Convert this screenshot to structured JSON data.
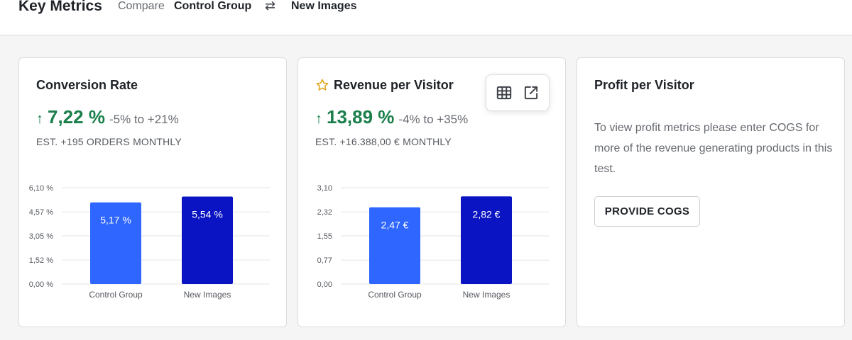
{
  "header": {
    "title": "Key Metrics",
    "compare_label": "Compare",
    "group_a": "Control Group",
    "swap_icon": "⇄",
    "group_b": "New Images"
  },
  "colors": {
    "positive": "#1a7f4b",
    "control_bar": "#2e66ff",
    "variant_bar": "#0a14c2"
  },
  "cards": {
    "conversion": {
      "title": "Conversion Rate",
      "arrow": "↑",
      "value": "7,22 %",
      "range": "-5% to +21%",
      "estimate": "EST. +195 ORDERS MONTHLY"
    },
    "revenue": {
      "title": "Revenue per Visitor",
      "arrow": "↑",
      "value": "13,89 %",
      "range": "-4% to +35%",
      "estimate": "EST. +16.388,00 € MONTHLY",
      "icons": [
        "star-icon",
        "table-icon",
        "external-link-icon"
      ]
    },
    "profit": {
      "title": "Profit per Visitor",
      "text": "To view profit metrics please enter COGS for more of the revenue generating products in this test.",
      "button_label": "PROVIDE COGS"
    }
  },
  "chart_data": [
    {
      "type": "bar",
      "categories": [
        "Control Group",
        "New Images"
      ],
      "values": [
        5.17,
        5.54
      ],
      "data_labels": [
        "5,17 %",
        "5,54 %"
      ],
      "yticks": [
        "0,00 %",
        "1,52 %",
        "3,05 %",
        "4,57 %",
        "6,10 %"
      ],
      "ytick_values": [
        0,
        1.52,
        3.05,
        4.57,
        6.1
      ],
      "ylim": [
        0,
        6.1
      ],
      "grid": true
    },
    {
      "type": "bar",
      "categories": [
        "Control Group",
        "New Images"
      ],
      "values": [
        2.47,
        2.82
      ],
      "data_labels": [
        "2,47 €",
        "2,82 €"
      ],
      "yticks": [
        "0,00",
        "0,77",
        "1,55",
        "2,32",
        "3,10"
      ],
      "ytick_values": [
        0,
        0.77,
        1.55,
        2.32,
        3.1
      ],
      "ylim": [
        0,
        3.1
      ],
      "grid": true
    }
  ]
}
